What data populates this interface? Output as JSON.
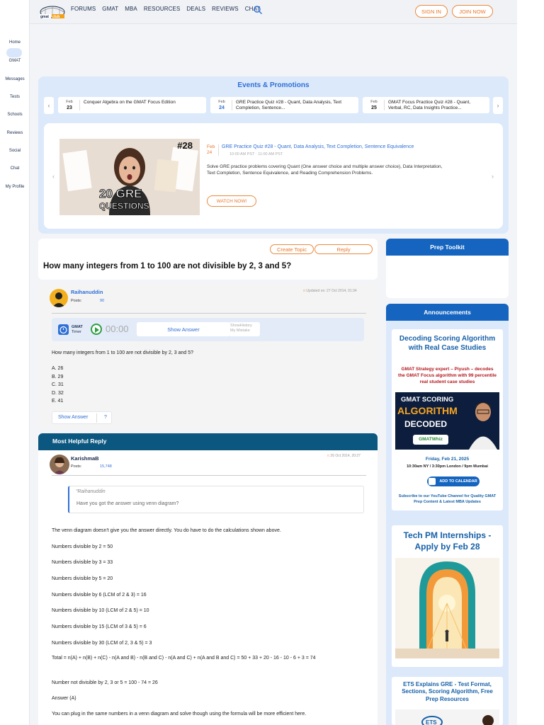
{
  "nav": {
    "items": [
      "FORUMS",
      "GMAT",
      "MBA",
      "RESOURCES",
      "DEALS",
      "REVIEWS",
      "CHAT"
    ],
    "sign_in": "SIGN IN",
    "join_now": "JOIN NOW"
  },
  "sidebar": {
    "items": [
      "Home",
      "GMAT",
      "Messages",
      "Tests",
      "Schools",
      "Reviews",
      "Social",
      "Chat",
      "My Profile"
    ]
  },
  "events": {
    "title": "Events & Promotions",
    "cards": [
      {
        "month": "Feb",
        "day": "23",
        "text": "Conquer Algebra on the GMAT Focus Edition"
      },
      {
        "month": "Feb",
        "day": "24",
        "text": "GRE Practice Quiz #28 - Quant, Data Analysis, Text Completion, Sentence..."
      },
      {
        "month": "Feb",
        "day": "25",
        "text": "GMAT Focus Practice Quiz #28 - Quant, Verbal, RC, Data Insights Practice..."
      }
    ],
    "featured": {
      "badge": "#28",
      "img_line1": "20 GRE",
      "img_line2": "QUESTIONS",
      "month": "Feb",
      "day": "24",
      "link": "GRE Practice Quiz #28 - Quant, Data Analysis, Text Completion, Sentence Equivalence",
      "time": "10:00 AM PST  ·  11:00 AM PST",
      "desc": "Solve GRE practice problems covering Quant (One answer choice and multiple answer choice), Data Interpretation, Text Completion, Sentence Equivalence, and Reading Comprehension Problems.",
      "cta": "WATCH NOW!"
    }
  },
  "topic": {
    "new_topic": "Create Topic",
    "reply": "Reply",
    "title": "How many integers from 1 to 100 are not divisible by 2, 3 and 5?"
  },
  "post": {
    "author": "Raihanuddin",
    "posts_label": "Posts:",
    "posts_count": "90",
    "updated": "Updated on: 27 Oct 2014, 01:34",
    "timer_label1": "GMAT",
    "timer_label2": "Timer",
    "timer_value": "00:00",
    "show_answer": "Show Answer",
    "show_history": "ShowHistory",
    "my_mistake": "My Mistake",
    "question": "How many integers from 1 to 100 are not divisible by 2, 3 and 5?",
    "choices": [
      "A. 26",
      "B. 29",
      "C. 31",
      "D. 32",
      "E. 41"
    ],
    "show_answer_btn": "Show Answer",
    "help": "?"
  },
  "reply": {
    "header": "Most Helpful Reply",
    "author": "KarishmaB",
    "posts_label": "Posts:",
    "posts_count": "15,748",
    "date": "26 Oct 2014, 20:27",
    "quote_author": "Raihanuddin",
    "quote_text": "Have you got the answer using venn diagram?",
    "lines": [
      "The venn diagram doesn't give you the answer directly. You do have to do the calculations shown above.",
      "Numbers divisible by 2 = 50",
      "Numbers divisible by 3 = 33",
      "Numbers divisible by 5 = 20",
      "Numbers divisible by 6 (LCM of 2 & 3) = 16",
      "Numbers divisible by 10 (LCM of 2 & 5) = 10",
      "Numbers divisible by 15 (LCM of 3 & 5) = 6",
      "Numbers divisible by 30 (LCM of 2, 3 & 5) = 3",
      "Total = n(A) + n(B) + n(C) - n(A and B) - n(B and C) - n(A and C) + n(A and B and C) = 50 + 33 + 20 - 16 - 10 - 6 + 3 = 74",
      "Number not divisible by 2, 3 or 5 = 100 - 74 = 26",
      "Answer (A)",
      "You can plug in the same numbers in a venn diagram and solve though using the formula will be more efficient here."
    ]
  },
  "right": {
    "prep_title": "Prep Toolkit",
    "ann_title": "Announcements",
    "ad1": {
      "title": "Decoding Scoring Algorithm with Real Case Studies",
      "subtitle": "GMAT Strategy expert – Piyush – decodes the GMAT Focus algorithm with 99 percentile real student case studies",
      "img_l1": "GMAT SCORING",
      "img_l2": "ALGORITHM",
      "img_l3": "DECODED",
      "img_badge": "GMATWhiz",
      "date": "Friday, Feb 21, 2025",
      "time": "10:30am NY / 3:30pm London / 9pm Mumbai",
      "cta": "ADD TO CALENDAR",
      "footer": "Subscribe to our YouTube Channel for Quality GMAT Prep Content & Latest MBA Updates"
    },
    "ad2": {
      "title": "Tech PM Internships - Apply by Feb 28"
    },
    "ad3": {
      "title": "ETS Explains GRE - Test Format, Sections, Scoring Algorithm, Free Prep Resources"
    }
  }
}
